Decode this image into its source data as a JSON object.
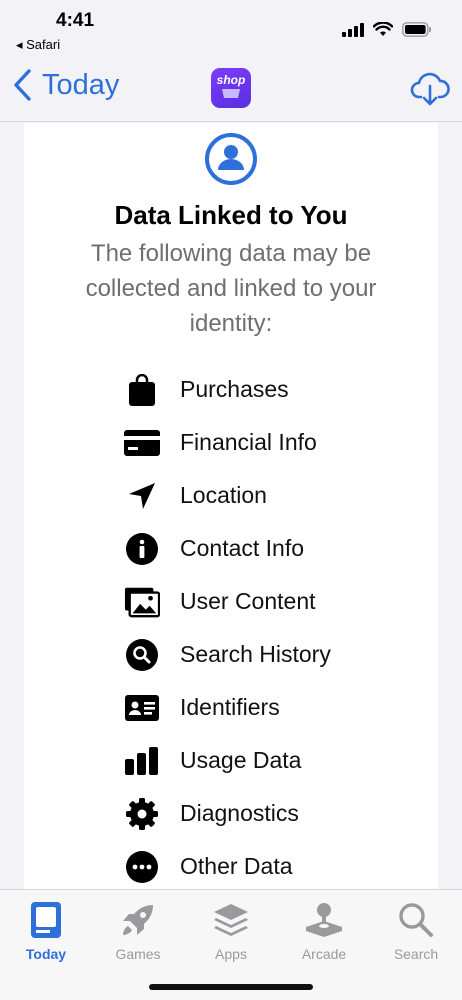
{
  "status": {
    "time": "4:41",
    "back_app": "◂ Safari"
  },
  "nav": {
    "back_label": "Today",
    "app_icon_label": "shop"
  },
  "section": {
    "title": "Data Linked to You",
    "subtitle": "The following data may be collected and linked to your identity:"
  },
  "items": [
    {
      "label": "Purchases",
      "icon": "bag-icon"
    },
    {
      "label": "Financial Info",
      "icon": "credit-card-icon"
    },
    {
      "label": "Location",
      "icon": "location-arrow-icon"
    },
    {
      "label": "Contact Info",
      "icon": "info-circle-icon"
    },
    {
      "label": "User Content",
      "icon": "photos-icon"
    },
    {
      "label": "Search History",
      "icon": "search-circle-icon"
    },
    {
      "label": "Identifiers",
      "icon": "id-card-icon"
    },
    {
      "label": "Usage Data",
      "icon": "bar-chart-icon"
    },
    {
      "label": "Diagnostics",
      "icon": "gear-icon"
    },
    {
      "label": "Other Data",
      "icon": "ellipsis-circle-icon"
    }
  ],
  "tabs": [
    {
      "label": "Today",
      "icon": "today-icon",
      "active": true
    },
    {
      "label": "Games",
      "icon": "rocket-icon",
      "active": false
    },
    {
      "label": "Apps",
      "icon": "layers-icon",
      "active": false
    },
    {
      "label": "Arcade",
      "icon": "joystick-icon",
      "active": false
    },
    {
      "label": "Search",
      "icon": "search-icon",
      "active": false
    }
  ],
  "colors": {
    "accent": "#2f6fd9",
    "inactive": "#9a9a9e",
    "subtitle": "#6e6e73",
    "app_icon": "#6a34f0"
  }
}
